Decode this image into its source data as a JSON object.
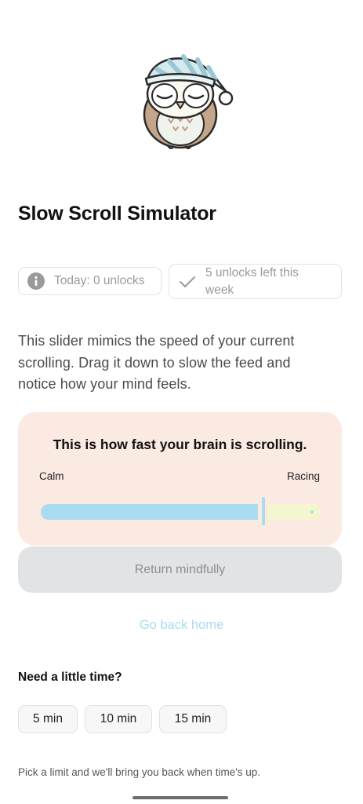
{
  "header": {
    "title": "Slow Scroll Simulator",
    "mascot_icon": "sleeping-owl-icon"
  },
  "stats": {
    "today_label": "Today: 0 unlocks",
    "today_icon": "info-icon",
    "week_label": "5 unlocks left this week",
    "week_icon": "check-icon"
  },
  "description": "This slider mimics the speed of your current scrolling. Drag it down to slow the feed and notice how your mind feels.",
  "simulator": {
    "heading": "This is how fast your brain is scrolling.",
    "min_label": "Calm",
    "max_label": "Racing",
    "value_fraction": 0.79,
    "fill_color": "#a9dcee",
    "rest_color": "#f4f6cf",
    "background_color": "#fbeae1"
  },
  "actions": {
    "return_label": "Return mindfully",
    "home_label": "Go back home"
  },
  "timer": {
    "title": "Need a little time?",
    "options": [
      "5 min",
      "10 min",
      "15 min"
    ],
    "hint": "Pick a limit and we'll bring you back when time's up."
  }
}
